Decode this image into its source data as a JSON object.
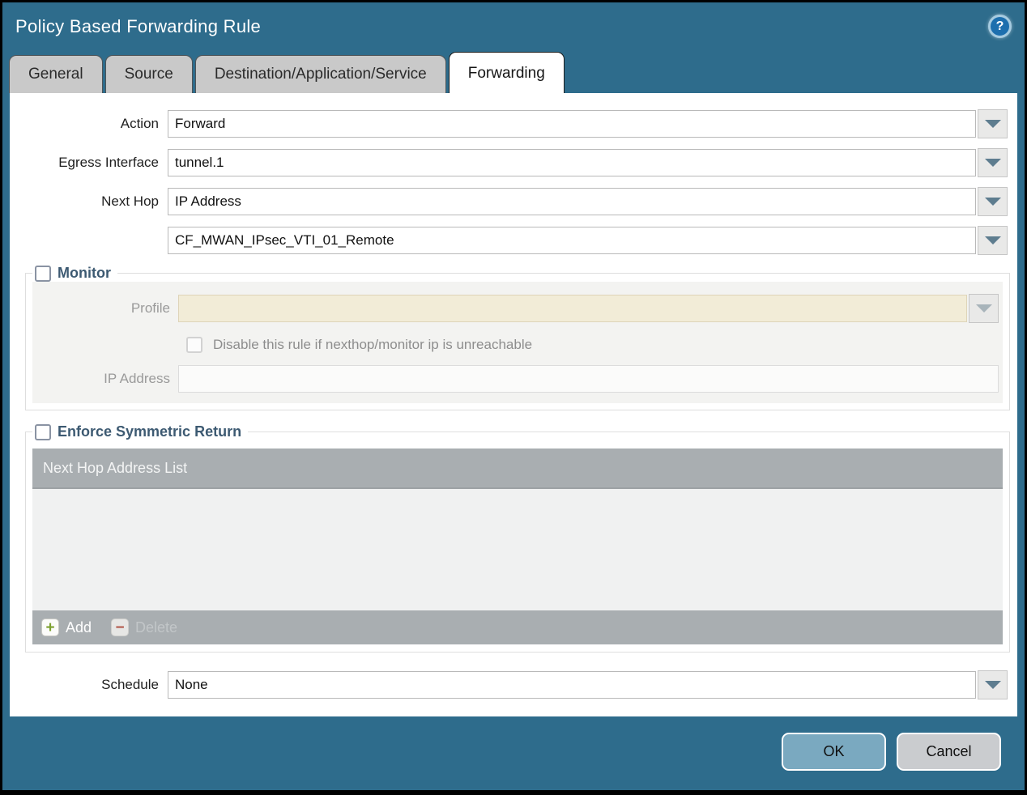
{
  "dialog": {
    "title": "Policy Based Forwarding Rule",
    "help_glyph": "?"
  },
  "tabs": [
    {
      "label": "General",
      "active": false
    },
    {
      "label": "Source",
      "active": false
    },
    {
      "label": "Destination/Application/Service",
      "active": false
    },
    {
      "label": "Forwarding",
      "active": true
    }
  ],
  "form": {
    "action": {
      "label": "Action",
      "value": "Forward"
    },
    "egress_interface": {
      "label": "Egress Interface",
      "value": "tunnel.1"
    },
    "next_hop": {
      "label": "Next Hop",
      "value": "IP Address"
    },
    "next_hop_address": {
      "value": "CF_MWAN_IPsec_VTI_01_Remote"
    },
    "schedule": {
      "label": "Schedule",
      "value": "None"
    }
  },
  "monitor": {
    "title": "Monitor",
    "checked": false,
    "profile": {
      "label": "Profile",
      "value": ""
    },
    "disable_rule_label": "Disable this rule if nexthop/monitor ip is unreachable",
    "disable_rule_checked": false,
    "ip_address": {
      "label": "IP Address",
      "value": ""
    }
  },
  "symmetric_return": {
    "title": "Enforce Symmetric Return",
    "checked": false,
    "table": {
      "header": "Next Hop Address List",
      "rows": []
    },
    "add_label": "Add",
    "add_icon_glyph": "+",
    "delete_label": "Delete",
    "delete_icon_glyph": "−"
  },
  "footer": {
    "ok_label": "OK",
    "cancel_label": "Cancel"
  },
  "colors": {
    "chrome_teal": "#2e6c8c",
    "active_tab_bg": "#ffffff",
    "inactive_tab_bg": "#c9c9c9",
    "section_title": "#3d5a72",
    "disabled_input_bg": "#f2ecd7",
    "table_bar_gray": "#a9aeb1",
    "table_body_gray": "#f0f1f1",
    "ok_button_bg": "#7aa9c0",
    "cancel_button_bg": "#cacccf",
    "add_plus_green": "#7ca02f",
    "delete_minus_red": "#b2584a"
  }
}
